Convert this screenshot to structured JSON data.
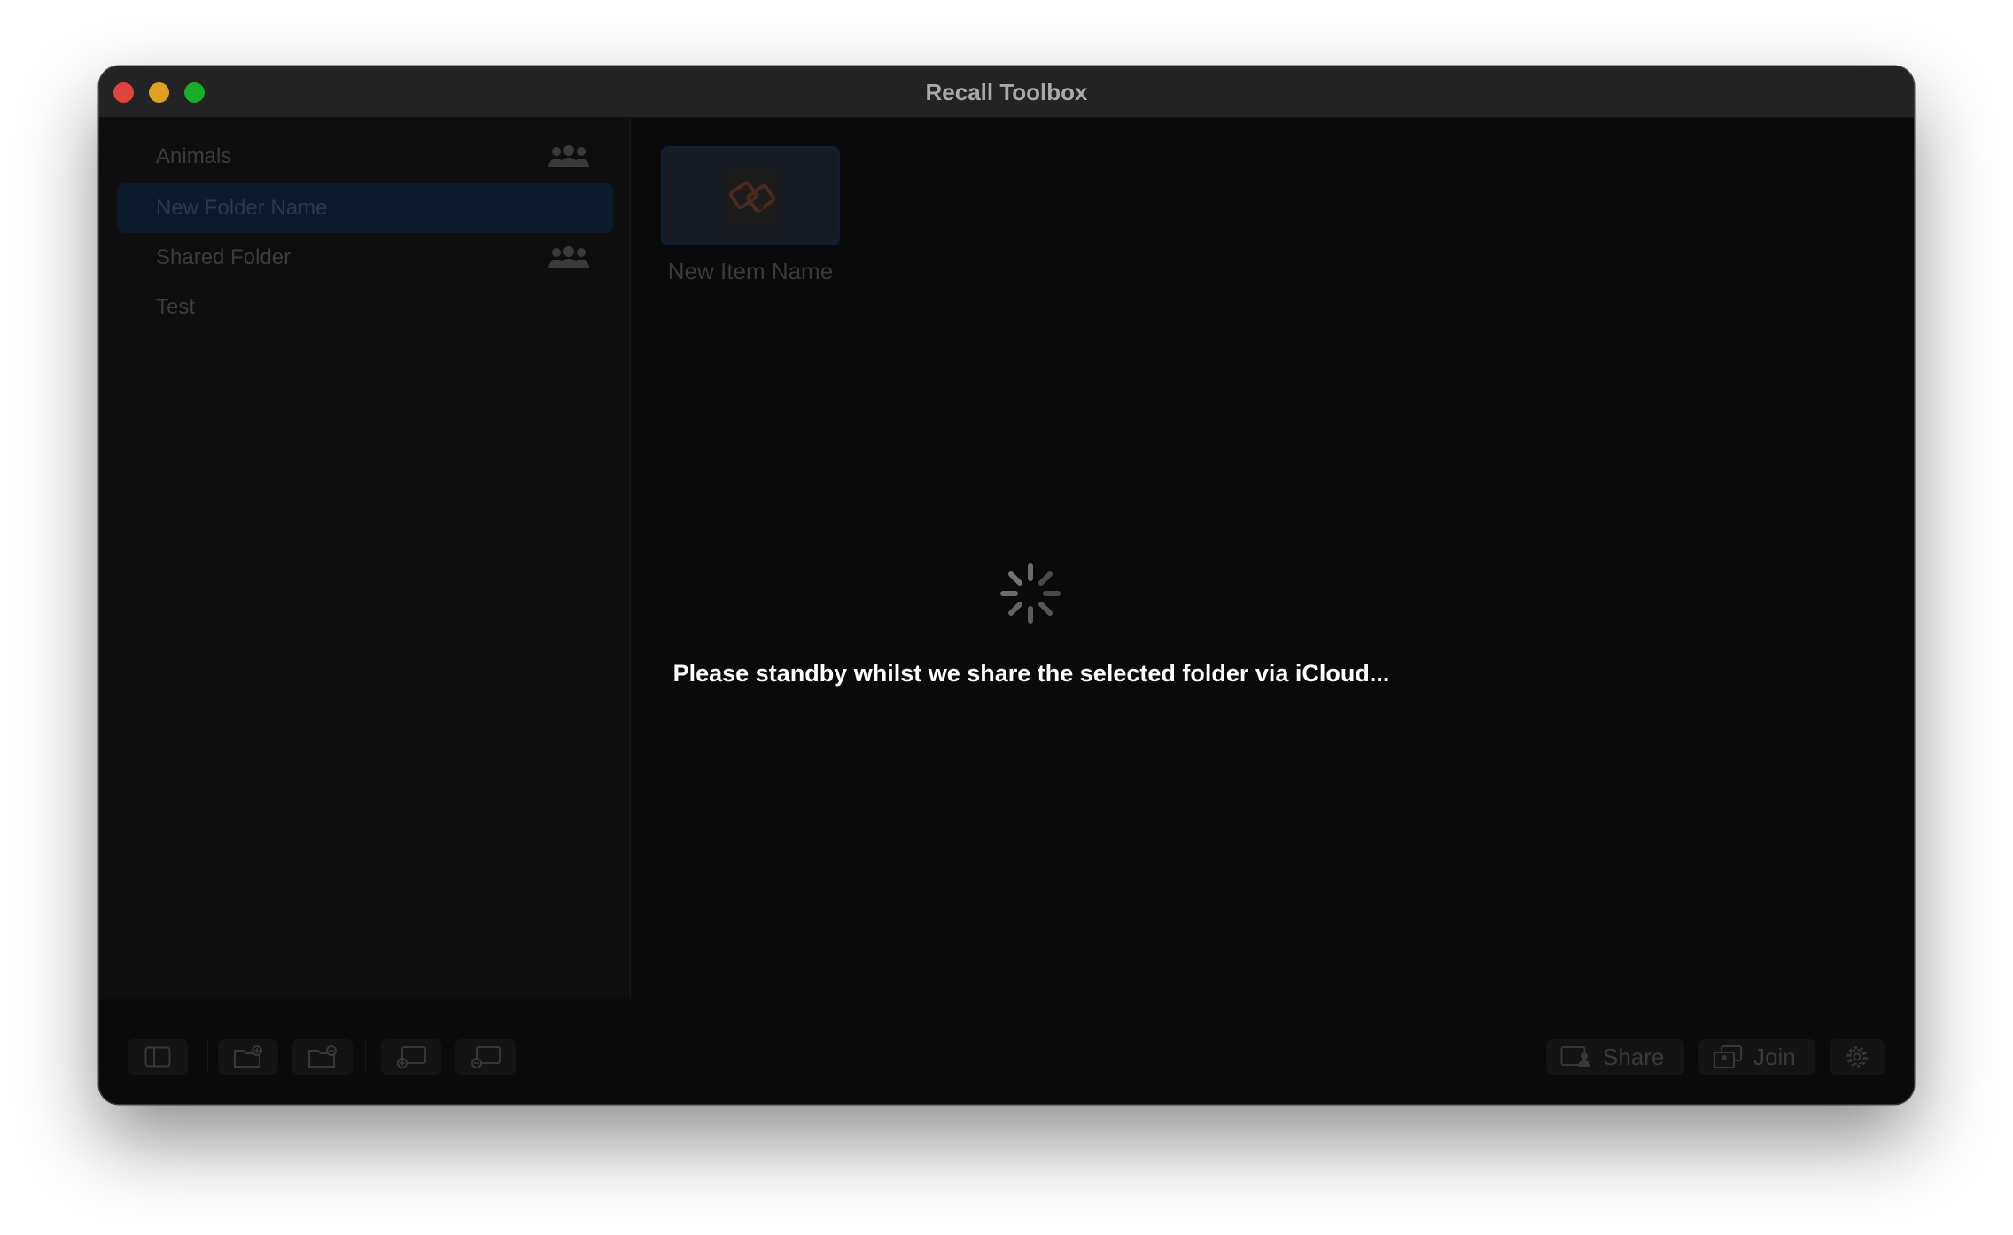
{
  "window": {
    "title": "Recall Toolbox"
  },
  "sidebar": {
    "folders": [
      {
        "label": "Animals",
        "shared": true,
        "selected": false
      },
      {
        "label": "New Folder Name",
        "shared": false,
        "selected": true
      },
      {
        "label": "Shared Folder",
        "shared": true,
        "selected": false
      },
      {
        "label": "Test",
        "shared": false,
        "selected": false
      }
    ]
  },
  "content": {
    "items": [
      {
        "label": "New Item Name",
        "icon": "item-app-icon"
      }
    ],
    "status": {
      "message": "Please standby whilst we share the selected folder via iCloud...",
      "icon": "spinner-icon"
    }
  },
  "toolbar": {
    "left_buttons": [
      {
        "icon": "sidebar-toggle-icon"
      },
      {
        "icon": "add-folder-icon"
      },
      {
        "icon": "remove-folder-icon"
      },
      {
        "icon": "add-item-icon"
      },
      {
        "icon": "remove-item-icon"
      }
    ],
    "share_label": "Share",
    "join_label": "Join",
    "settings_icon": "gear-icon"
  }
}
